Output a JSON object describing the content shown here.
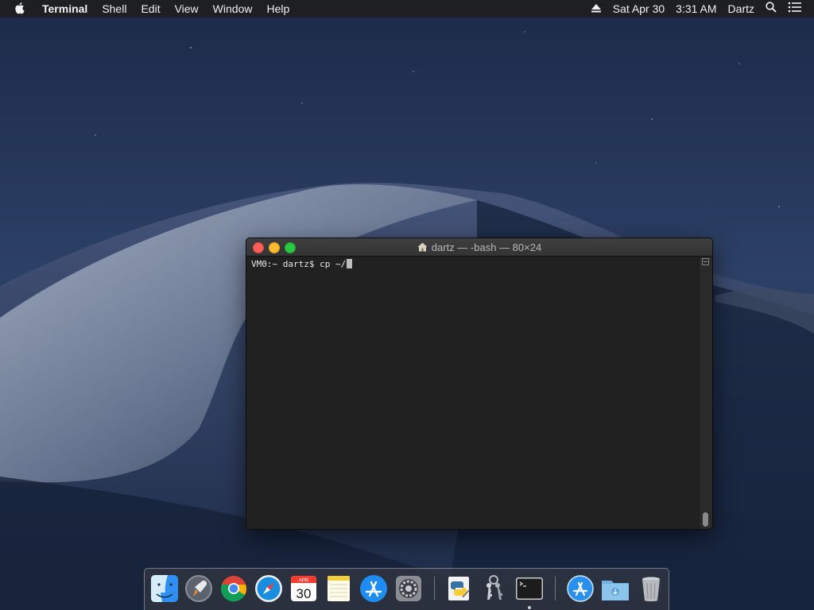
{
  "menubar": {
    "app_name": "Terminal",
    "items": [
      "Shell",
      "Edit",
      "View",
      "Window",
      "Help"
    ],
    "date": "Sat Apr 30",
    "time": "3:31 AM",
    "user": "Dartz"
  },
  "terminal": {
    "title": "dartz — -bash — 80×24",
    "prompt": "VM0:~ dartz$ ",
    "command": "cp ~/"
  },
  "dock": {
    "calendar_month": "APR",
    "calendar_day": "30",
    "apps": [
      "finder-icon",
      "launchpad-icon",
      "chrome-icon",
      "safari-icon",
      "calendar-icon",
      "notes-icon",
      "app-store-icon",
      "system-preferences-icon",
      "python-launcher-icon",
      "keychain-access-icon",
      "terminal-icon",
      "app-store-download-icon",
      "downloads-folder-icon",
      "trash-icon"
    ]
  }
}
